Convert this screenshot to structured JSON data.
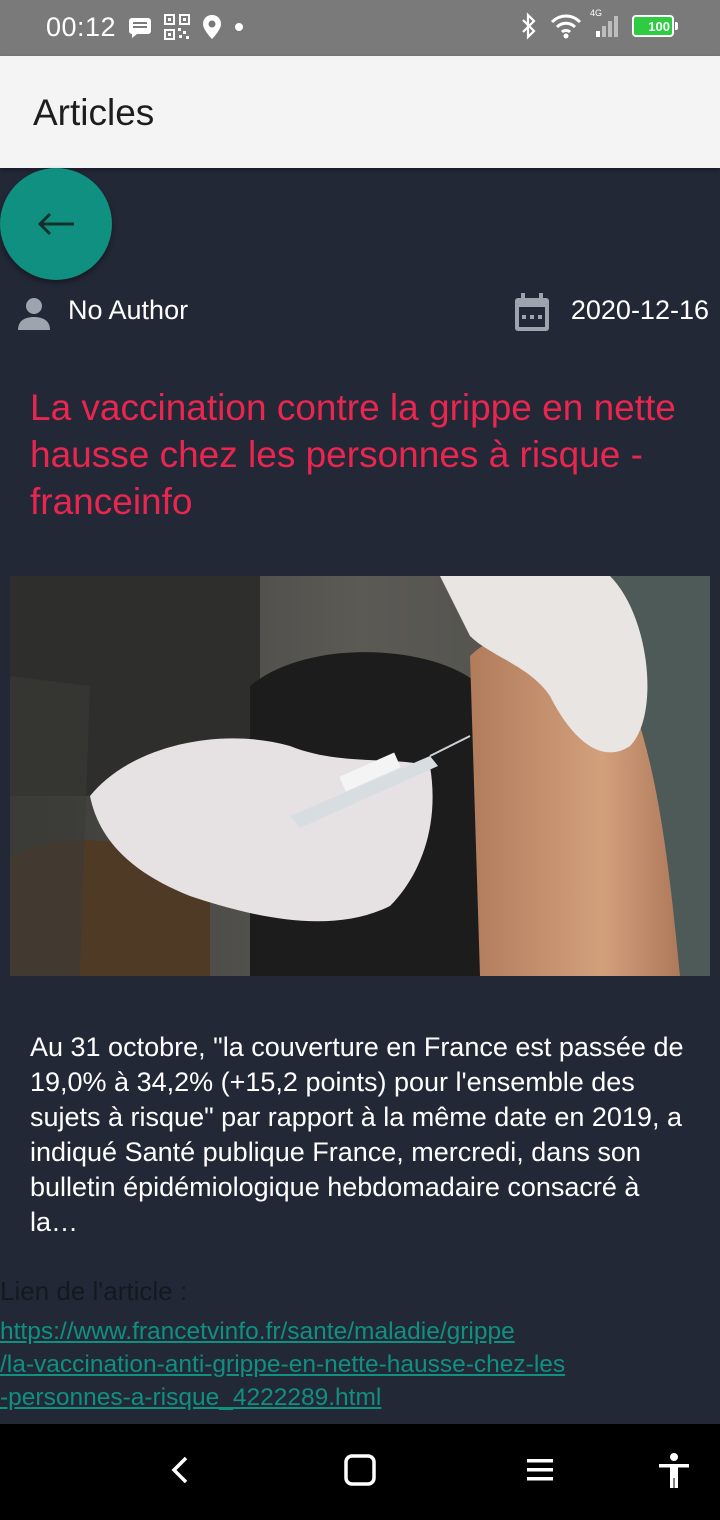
{
  "status_bar": {
    "time": "00:12",
    "network": "4G",
    "battery": "100"
  },
  "app_bar": {
    "title": "Articles"
  },
  "article": {
    "author": "No Author",
    "date": "2020-12-16",
    "title": "La vaccination contre la grippe en nette hausse chez les personnes à risque - franceinfo",
    "description": "Au 31 octobre, \"la couverture en France est passée de 19,0% à 34,2% (+15,2 points) pour l'ensemble des sujets à risque\" par rapport à la même date en 2019, a indiqué Santé publique France, mercredi, dans son bulletin épidémiologique hebdomadaire consacré à la…",
    "link_label": "Lien de l'article :",
    "link_url": "https://www.francetvinfo.fr/sante/maladie/grippe\n/la-vaccination-anti-grippe-en-nette-hausse-chez-les\n-personnes-a-risque_4222289.html"
  },
  "colors": {
    "background": "#232837",
    "accent": "#0f9080",
    "title": "#e8264f"
  }
}
